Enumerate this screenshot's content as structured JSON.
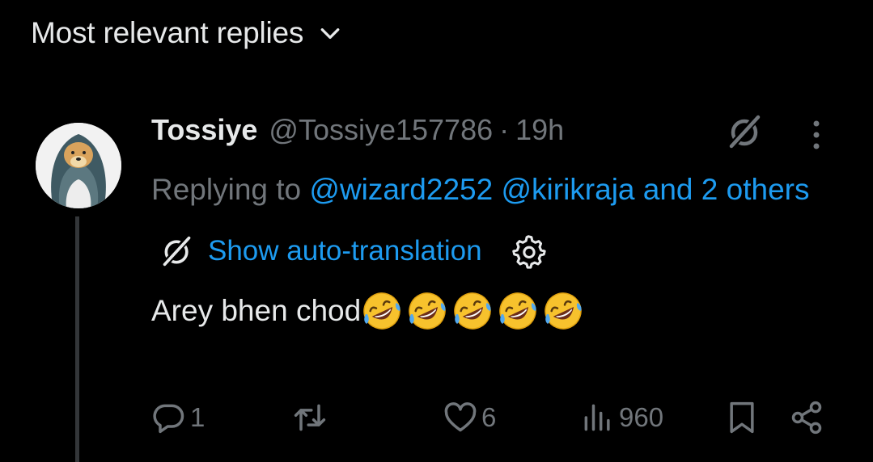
{
  "header": {
    "title": "Most relevant replies",
    "chevron_icon": "chevron-down-icon"
  },
  "tweet": {
    "display_name": "Tossiye",
    "handle": "@Tossiye157786",
    "separator": "·",
    "time": "19h",
    "replying_prefix": "Replying to ",
    "mention_1": "@wizard2252",
    "mention_2": "@kirikraja",
    "mention_rest": "and 2 others",
    "translate_label": "Show auto-translation",
    "text": "Arey bhen chod",
    "emoji_name": "rolling-on-floor-laughing",
    "emoji_count": 5
  },
  "actions": {
    "reply_count": "1",
    "repost_count": "",
    "like_count": "6",
    "views_count": "960"
  },
  "colors": {
    "background": "#000000",
    "text": "#e7e9ea",
    "muted": "#71767b",
    "accent": "#1d9bf0"
  }
}
